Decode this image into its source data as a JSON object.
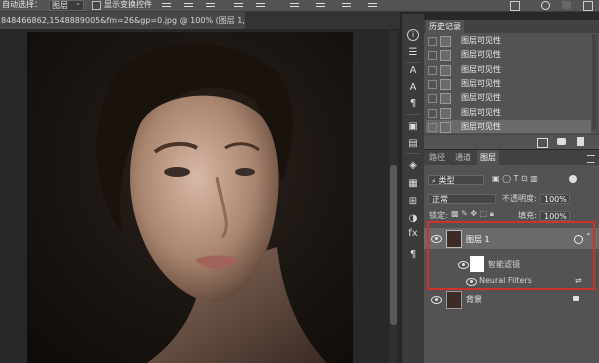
{
  "option_bar": {
    "auto_select_label": "自动选择：",
    "auto_select_value": "图层",
    "show_transform_label": "显示变换控件"
  },
  "document_tab": {
    "title": "848466862,1548889005&fm=26&gp=0.jpg @ 100% (图层 1, RGB/8#) *",
    "close": "×"
  },
  "history_panel": {
    "tab": "历史记录",
    "items": [
      {
        "label": "图层可见性",
        "active": false
      },
      {
        "label": "图层可见性",
        "active": false
      },
      {
        "label": "图层可见性",
        "active": false
      },
      {
        "label": "图层可见性",
        "active": false
      },
      {
        "label": "图层可见性",
        "active": false
      },
      {
        "label": "图层可见性",
        "active": false
      },
      {
        "label": "图层可见性",
        "active": true
      }
    ]
  },
  "layers_panel": {
    "tabs": [
      {
        "label": "路径",
        "active": false
      },
      {
        "label": "通道",
        "active": false
      },
      {
        "label": "图层",
        "active": true
      }
    ],
    "filter_kind": "类型",
    "blend_mode": "正常",
    "opacity_label": "不透明度:",
    "opacity_value": "100%",
    "lock_label": "锁定:",
    "fill_label": "填充:",
    "fill_value": "100%",
    "layers": [
      {
        "name": "图层 1",
        "selected": true
      },
      {
        "name": "智能滤镜"
      },
      {
        "name": "Neural Filters"
      },
      {
        "name": "背景"
      }
    ]
  },
  "colors": {
    "highlight_box": "#d0312d",
    "panel_bg": "#535353",
    "workspace_bg": "#282828"
  }
}
